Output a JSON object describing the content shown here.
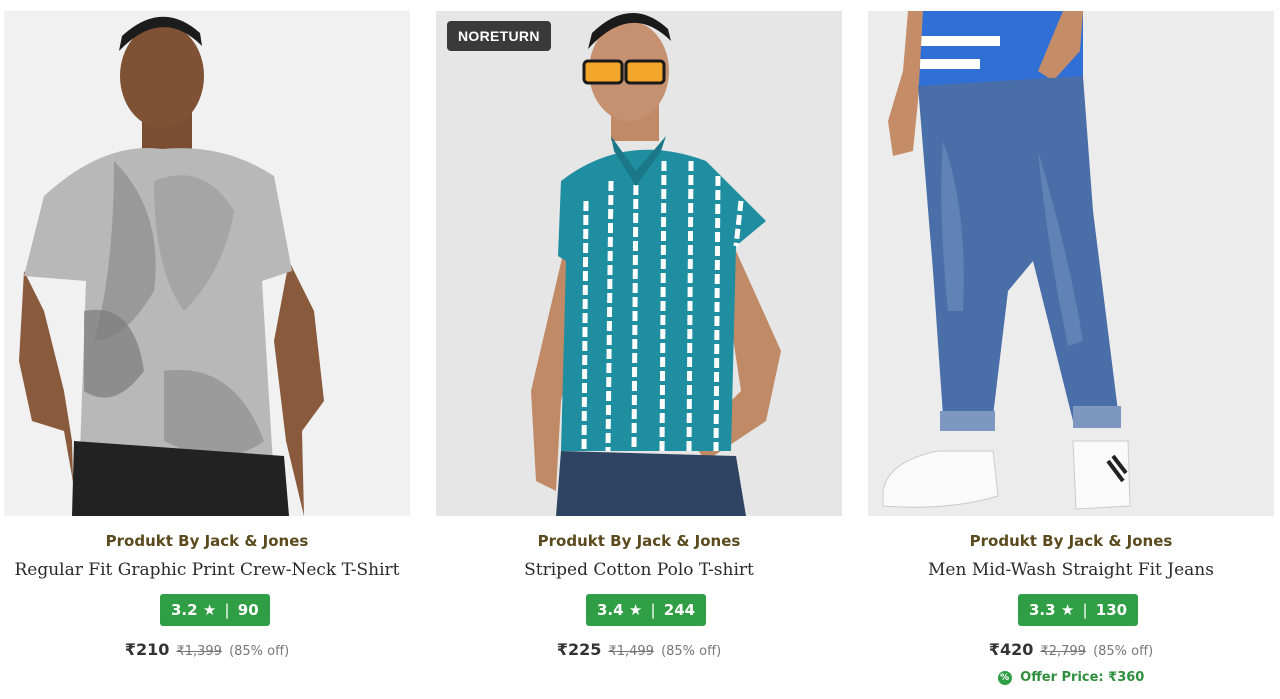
{
  "products": [
    {
      "brand": "Produkt By Jack & Jones",
      "title": "Regular Fit Graphic Print Crew-Neck T-Shirt",
      "rating": "3.2",
      "rating_star": "★",
      "rating_sep": "|",
      "rating_count": "90",
      "price": "₹210",
      "mrp": "₹1,399",
      "discount": "(85% off)"
    },
    {
      "badge": "NORETURN",
      "brand": "Produkt By Jack & Jones",
      "title": "Striped Cotton Polo T-shirt",
      "rating": "3.4",
      "rating_star": "★",
      "rating_sep": "|",
      "rating_count": "244",
      "price": "₹225",
      "mrp": "₹1,499",
      "discount": "(85% off)"
    },
    {
      "brand": "Produkt By Jack & Jones",
      "title": "Men Mid-Wash Straight Fit Jeans",
      "rating": "3.3",
      "rating_star": "★",
      "rating_sep": "|",
      "rating_count": "130",
      "price": "₹420",
      "mrp": "₹2,799",
      "discount": "(85% off)",
      "offer_icon": "%",
      "offer_text": "Offer Price: ₹360"
    }
  ],
  "colors": {
    "brand_text": "#5a4a1e",
    "rating_bg": "#2f9e44",
    "offer_text": "#2f8f3e",
    "badge_bg": "#3a3a3a"
  }
}
